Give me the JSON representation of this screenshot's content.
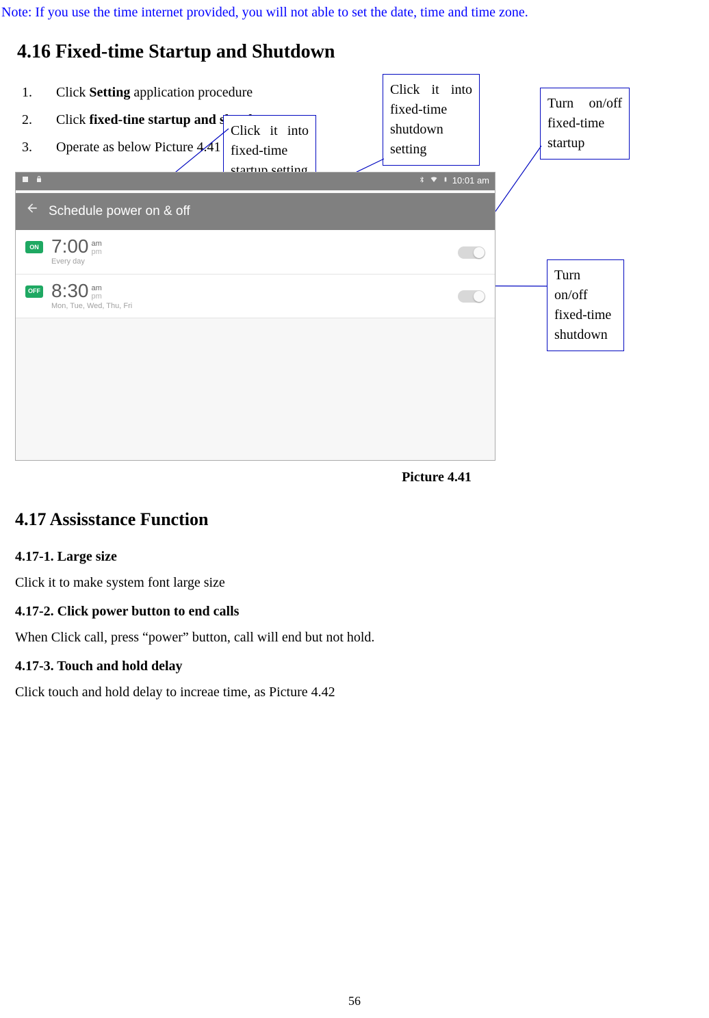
{
  "note": "Note: If you use the time internet provided, you will not able to set the date, time and time zone.",
  "section_416": "4.16 Fixed-time Startup and Shutdown",
  "steps": {
    "s1a": "Click ",
    "s1b": "Setting",
    "s1c": " application procedure",
    "s2a": "Click ",
    "s2b": "fixed-tine startup and shutdown.",
    "s3": "Operate as below Picture 4.41"
  },
  "callouts": {
    "startup_setting": "Click it into fixed-time startup setting",
    "shutdown_setting": "Click it into fixed-time shutdown setting",
    "startup_toggle": "Turn on/off fixed-time startup",
    "shutdown_toggle": "Turn on/off fixed-time shutdown"
  },
  "screenshot": {
    "title": "Schedule power on & off",
    "statusbar_time": "10:01 am",
    "item1": {
      "badge": "ON",
      "time": "7:00",
      "ampm_active": "am",
      "ampm_inactive": "pm",
      "days": "Every day"
    },
    "item2": {
      "badge": "OFF",
      "time": "8:30",
      "ampm_active": "am",
      "ampm_inactive": "pm",
      "days": "Mon, Tue, Wed, Thu, Fri"
    }
  },
  "figure_caption": "Picture 4.41",
  "section_417": "4.17 Assisstance Function",
  "sub1": "4.17-1. Large size",
  "sub1_text": "Click it to make system font large size",
  "sub2": "4.17-2. Click power button to end calls",
  "sub2_text": "When Click call, press “power” button, call will end but not hold.",
  "sub3": "4.17-3. Touch and hold delay",
  "sub3_text": "Click touch and hold delay to increae time, as Picture 4.42",
  "page_num": "56"
}
